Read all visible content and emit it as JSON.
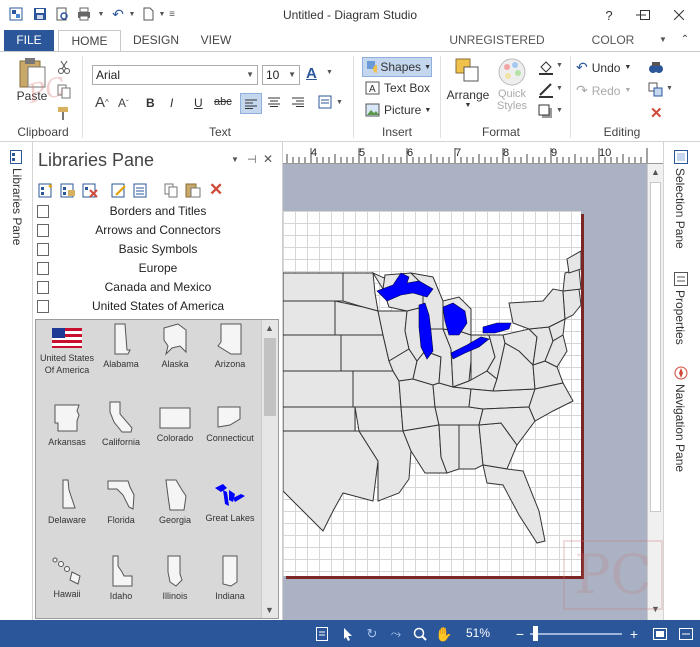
{
  "window": {
    "title": "Untitled - Diagram Studio",
    "min_icon": "minimize-icon",
    "max_icon": "maximize-icon",
    "close_icon": "close-icon"
  },
  "tabs": {
    "file": "FILE",
    "home": "HOME",
    "design": "DESIGN",
    "view": "VIEW",
    "unregistered": "UNREGISTERED VERSION",
    "color_scheme": "COLOR SCHEME"
  },
  "ribbon": {
    "clipboard": {
      "paste": "Paste",
      "label": "Clipboard"
    },
    "text": {
      "font": "Arial",
      "size": "10",
      "label": "Text"
    },
    "insert": {
      "shapes": "Shapes",
      "text_box": "Text Box",
      "picture": "Picture",
      "label": "Insert"
    },
    "format": {
      "arrange": "Arrange",
      "quick_styles_1": "Quick",
      "quick_styles_2": "Styles",
      "label": "Format"
    },
    "editing": {
      "undo": "Undo",
      "redo": "Redo",
      "label": "Editing"
    }
  },
  "left_strip": {
    "label": "Libraries Pane"
  },
  "libraries": {
    "title": "Libraries Pane",
    "items": [
      "Borders and Titles",
      "Arrows and Connectors",
      "Basic Symbols",
      "Europe",
      "Canada and Mexico",
      "United States of America"
    ],
    "shapes": [
      {
        "label": "United States Of America"
      },
      {
        "label": "Alabama"
      },
      {
        "label": "Alaska"
      },
      {
        "label": "Arizona"
      },
      {
        "label": "Arkansas"
      },
      {
        "label": "California"
      },
      {
        "label": "Colorado"
      },
      {
        "label": "Connecticut"
      },
      {
        "label": "Delaware"
      },
      {
        "label": "Florida"
      },
      {
        "label": "Georgia"
      },
      {
        "label": "Great Lakes"
      },
      {
        "label": "Hawaii"
      },
      {
        "label": "Idaho"
      },
      {
        "label": "Illinois"
      },
      {
        "label": "Indiana"
      }
    ]
  },
  "ruler": {
    "labels": [
      "4",
      "5",
      "6",
      "7",
      "8",
      "9",
      "10"
    ]
  },
  "right_strip": {
    "selection": "Selection Pane",
    "properties": "Properties",
    "navigation": "Navigation Pane"
  },
  "status": {
    "zoom": "51%"
  },
  "colors": {
    "accent": "#2b579a",
    "lakes": "#0000ff",
    "state_fill": "#e6e6e6"
  },
  "watermark": {
    "text": "PC",
    "script": "PC"
  }
}
